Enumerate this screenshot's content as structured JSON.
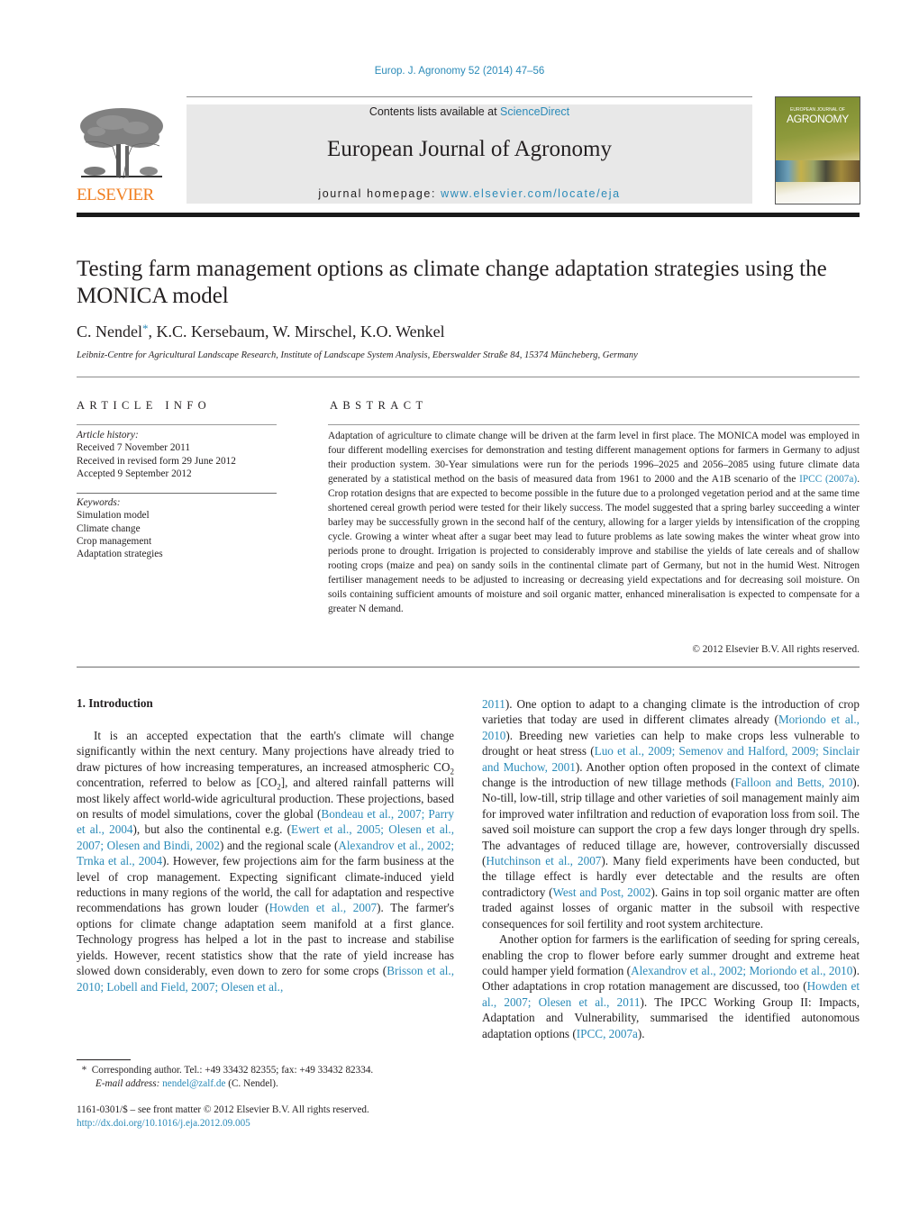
{
  "header": {
    "citation": "Europ. J. Agronomy 52 (2014) 47–56",
    "contents_prefix": "Contents lists available at ",
    "contents_link": "ScienceDirect",
    "journal_title": "European Journal of Agronomy",
    "homepage_prefix": "journal homepage: ",
    "homepage_url": "www.elsevier.com/locate/eja",
    "publisher_logo_text": "ELSEVIER",
    "cover": {
      "small_title": "EUROPEAN JOURNAL OF",
      "big_title": "AGRONOMY"
    },
    "colors": {
      "link": "#2a8ab8",
      "elsevier_orange": "#f07e1f",
      "masthead_bg": "#e8e8e8"
    }
  },
  "article": {
    "title": "Testing farm management options as climate change adaptation strategies using the MONICA model",
    "authors": [
      {
        "name": "C. Nendel",
        "corresponding": true
      },
      {
        "name": "K.C. Kersebaum"
      },
      {
        "name": "W. Mirschel"
      },
      {
        "name": "K.O. Wenkel"
      }
    ],
    "authors_rest": ", K.C. Kersebaum, W. Mirschel, K.O. Wenkel",
    "first_author": "C. Nendel",
    "corresponding_mark": "*",
    "affiliation": "Leibniz-Centre for Agricultural Landscape Research, Institute of Landscape System Analysis, Eberswalder Straße 84, 15374 Müncheberg, Germany"
  },
  "article_info": {
    "heading": "ARTICLE INFO",
    "history_label": "Article history:",
    "history": [
      "Received 7 November 2011",
      "Received in revised form 29 June 2012",
      "Accepted 9 September 2012"
    ],
    "keywords_label": "Keywords:",
    "keywords": [
      "Simulation model",
      "Climate change",
      "Crop management",
      "Adaptation strategies"
    ]
  },
  "abstract": {
    "heading": "ABSTRACT",
    "text_1": "Adaptation of agriculture to climate change will be driven at the farm level in first place. The MONICA model was employed in four different modelling exercises for demonstration and testing different management options for farmers in Germany to adjust their production system. 30-Year simulations were run for the periods 1996–2025 and 2056–2085 using future climate data generated by a statistical method on the basis of measured data from 1961 to 2000 and the A1B scenario of the ",
    "link_1": "IPCC (2007a)",
    "text_2": ". Crop rotation designs that are expected to become possible in the future due to a prolonged vegetation period and at the same time shortened cereal growth period were tested for their likely success. The model suggested that a spring barley succeeding a winter barley may be successfully grown in the second half of the century, allowing for a larger yields by intensification of the cropping cycle. Growing a winter wheat after a sugar beet may lead to future problems as late sowing makes the winter wheat grow into periods prone to drought. Irrigation is projected to considerably improve and stabilise the yields of late cereals and of shallow rooting crops (maize and pea) on sandy soils in the continental climate part of Germany, but not in the humid West. Nitrogen fertiliser management needs to be adjusted to increasing or decreasing yield expectations and for decreasing soil moisture. On soils containing sufficient amounts of moisture and soil organic matter, enhanced mineralisation is expected to compensate for a greater N demand.",
    "copyright": "© 2012 Elsevier B.V. All rights reserved."
  },
  "introduction": {
    "heading": "1.  Introduction",
    "left": [
      {
        "t": "It is an accepted expectation that the earth's climate will change significantly within the next century. Many projections have already tried to draw pictures of how increasing temperatures, an increased atmospheric CO"
      },
      {
        "sub": "2"
      },
      {
        "t": " concentration, referred to below as [CO"
      },
      {
        "sub": "2"
      },
      {
        "t": "], and altered rainfall patterns will most likely affect world-wide agricultural production. These projections, based on results of model simulations, cover the global ("
      },
      {
        "link": "Bondeau et al., 2007; Parry et al., 2004"
      },
      {
        "t": "), but also the continental e.g. ("
      },
      {
        "link": "Ewert et al., 2005; Olesen et al., 2007; Olesen and Bindi, 2002"
      },
      {
        "t": ") and the regional scale ("
      },
      {
        "link": "Alexandrov et al., 2002; Trnka et al., 2004"
      },
      {
        "t": "). However, few projections aim for the farm business at the level of crop management. Expecting significant climate-induced yield reductions in many regions of the world, the call for adaptation and respective recommendations has grown louder ("
      },
      {
        "link": "Howden et al., 2007"
      },
      {
        "t": "). The farmer's options for climate change adaptation seem manifold at a first glance. Technology progress has helped a lot in the past to increase and stabilise yields. However, recent statistics show that the rate of yield increase has slowed down considerably, even down to zero for some crops ("
      },
      {
        "link": "Brisson et al., 2010; Lobell and Field, 2007; Olesen et al.,"
      }
    ],
    "right_p1": [
      {
        "link": "2011"
      },
      {
        "t": "). One option to adapt to a changing climate is the introduction of crop varieties that today are used in different climates already ("
      },
      {
        "link": "Moriondo et al., 2010"
      },
      {
        "t": "). Breeding new varieties can help to make crops less vulnerable to drought or heat stress ("
      },
      {
        "link": "Luo et al., 2009; Semenov and Halford, 2009; Sinclair and Muchow, 2001"
      },
      {
        "t": "). Another option often proposed in the context of climate change is the introduction of new tillage methods ("
      },
      {
        "link": "Falloon and Betts, 2010"
      },
      {
        "t": "). No-till, low-till, strip tillage and other varieties of soil management mainly aim for improved water infiltration and reduction of evaporation loss from soil. The saved soil moisture can support the crop a few days longer through dry spells. The advantages of reduced tillage are, however, controversially discussed ("
      },
      {
        "link": "Hutchinson et al., 2007"
      },
      {
        "t": "). Many field experiments have been conducted, but the tillage effect is hardly ever detectable and the results are often contradictory ("
      },
      {
        "link": "West and Post, 2002"
      },
      {
        "t": "). Gains in top soil organic matter are often traded against losses of organic matter in the subsoil with respective consequences for soil fertility and root system architecture."
      }
    ],
    "right_p2": [
      {
        "t": "Another option for farmers is the earlification of seeding for spring cereals, enabling the crop to flower before early summer drought and extreme heat could hamper yield formation ("
      },
      {
        "link": "Alexandrov et al., 2002; Moriondo et al., 2010"
      },
      {
        "t": "). Other adaptations in crop rotation management are discussed, too ("
      },
      {
        "link": "Howden et al., 2007; Olesen et al., 2011"
      },
      {
        "t": "). The IPCC Working Group II: Impacts, Adaptation and Vulnerability, summarised the identified autonomous adaptation options ("
      },
      {
        "link": "IPCC, 2007a"
      },
      {
        "t": ")."
      }
    ]
  },
  "footnote": {
    "mark": "*",
    "text": "Corresponding author. Tel.: +49 33432 82355; fax: +49 33432 82334.",
    "email_label": "E-mail address: ",
    "email": "nendel@zalf.de",
    "email_suffix": " (C. Nendel)."
  },
  "front_matter": {
    "issn_line": "1161-0301/$ – see front matter © 2012 Elsevier B.V. All rights reserved.",
    "doi": "http://dx.doi.org/10.1016/j.eja.2012.09.005"
  }
}
